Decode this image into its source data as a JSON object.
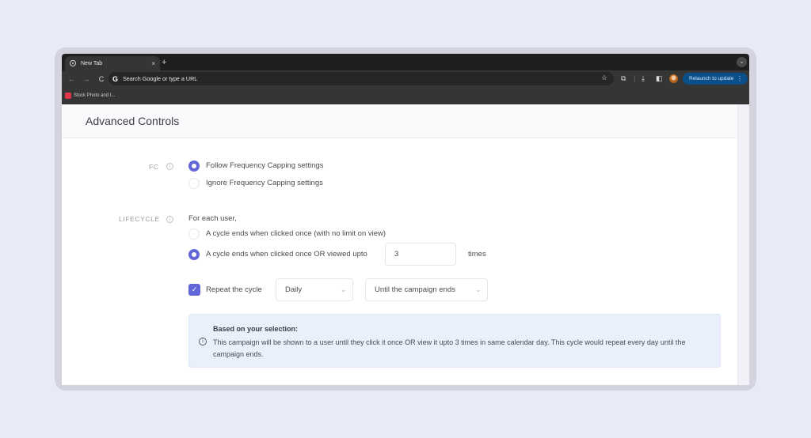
{
  "browser": {
    "tab_title": "New Tab",
    "tab_close": "×",
    "new_tab": "+",
    "tab_menu": "⌄",
    "nav": {
      "back": "←",
      "forward": "→",
      "reload": "C"
    },
    "omnibox_google": "G",
    "omnibox_placeholder": "Search Google or type a URL",
    "bookmark_star": "☆",
    "relaunch_label": "Relaunch to update",
    "relaunch_menu": "⋮",
    "bookmarks": [
      {
        "label": "Stock Photo and I..."
      }
    ]
  },
  "page": {
    "title": "Advanced Controls",
    "fc": {
      "label": "FC",
      "options": [
        {
          "label": "Follow Frequency Capping settings",
          "selected": true
        },
        {
          "label": "Ignore Frequency Capping settings",
          "selected": false
        }
      ]
    },
    "lifecycle": {
      "label": "LIFECYCLE",
      "intro": "For each user,",
      "options": [
        {
          "label": "A cycle ends when clicked once (with no limit on view)",
          "selected": false
        },
        {
          "label": "A cycle ends when clicked once OR viewed upto",
          "selected": true
        }
      ],
      "view_limit": "3",
      "view_limit_suffix": "times",
      "repeat": {
        "label": "Repeat the cycle",
        "checked": true,
        "frequency": "Daily",
        "until": "Until the campaign ends"
      }
    },
    "summary": {
      "title": "Based on your selection:",
      "text": "This campaign will be shown to a user until they click it once OR view it upto 3 times in same calendar day. This cycle would repeat every day until the campaign ends."
    }
  },
  "icons": {
    "info": "i",
    "check": "✓",
    "chevron": "⌄"
  },
  "colors": {
    "accent": "#6366d8",
    "relaunch_bg": "#0b4f8a",
    "summary_bg": "#e9effb"
  }
}
